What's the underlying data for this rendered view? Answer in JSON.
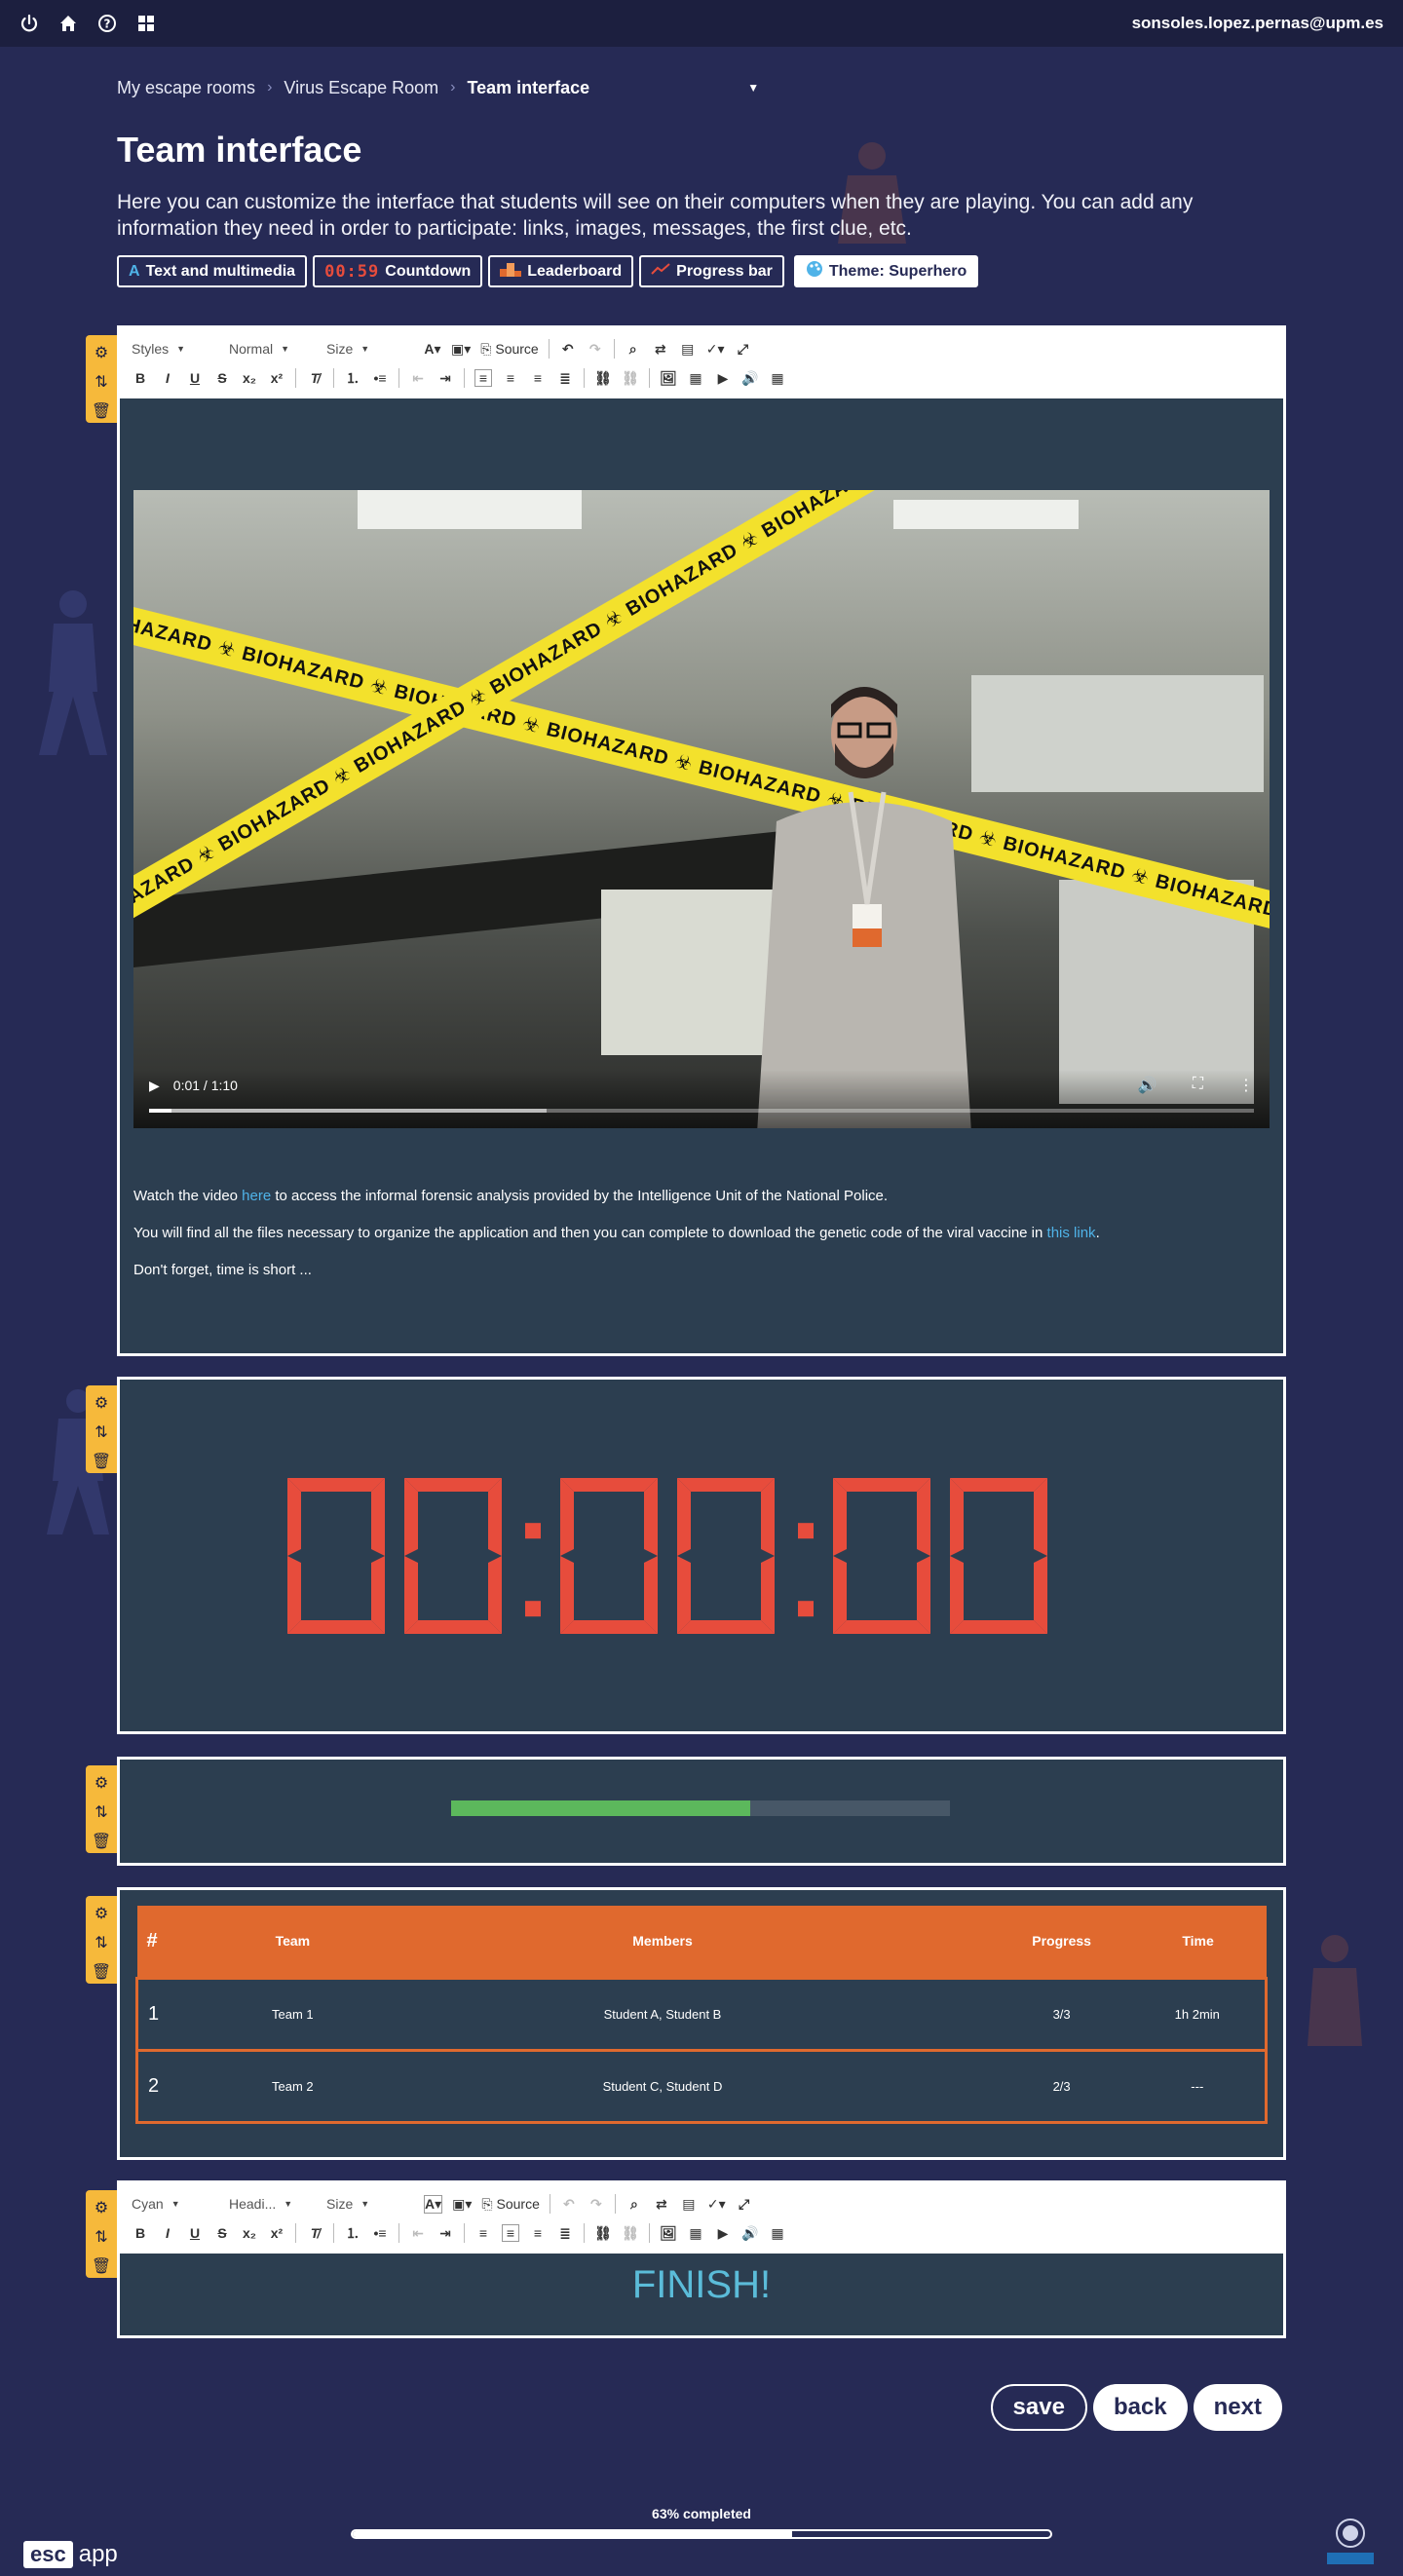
{
  "user": {
    "email": "sonsoles.lopez.pernas@upm.es"
  },
  "breadcrumb": {
    "item1": "My escape rooms",
    "item2": "Virus Escape Room",
    "current": "Team interface"
  },
  "page": {
    "title": "Team interface",
    "description": "Here you can customize the interface that students will see on their computers when they are playing. You can add any information they need in order to participate: links, images, messages, the first clue, etc."
  },
  "toolbar": {
    "text_multimedia": "Text and multimedia",
    "countdown_digits": "00:59",
    "countdown": "Countdown",
    "leaderboard": "Leaderboard",
    "progress_bar": "Progress bar",
    "theme": "Theme: Superhero"
  },
  "editor": {
    "styles": "Styles",
    "normal": "Normal",
    "size": "Size",
    "source": "Source"
  },
  "editor2": {
    "color": "Cyan",
    "heading": "Headi...",
    "size": "Size",
    "source": "Source"
  },
  "video": {
    "tape_text": "BIOHAZARD ☣ BIOHAZARD ☣ BIOHAZARD ☣ BIOHAZARD ☣ BIOHAZARD ☣ BIOHAZARD ☣ BIOHAZARD ☣ BIOHAZARD",
    "time": "0:01 / 1:10",
    "played_fraction": 0.02
  },
  "text_block": {
    "p1_before": "Watch the video ",
    "p1_link": "here",
    "p1_after": " to access the informal forensic analysis provided by the Intelligence Unit of the National Police.",
    "p2_before": "You will find all the files necessary to organize the application and then you can complete to download the genetic code of the viral vaccine in ",
    "p2_link": "this link",
    "p2_after": ".",
    "p3": "Don't forget, time is short ..."
  },
  "countdown": {
    "value": "00:00:00",
    "color": "#e74c3c"
  },
  "progress": {
    "fraction": 0.6
  },
  "leaderboard": {
    "headers": {
      "rank": "#",
      "team": "Team",
      "members": "Members",
      "progress": "Progress",
      "time": "Time"
    },
    "rows": [
      {
        "rank": "1",
        "team": "Team 1",
        "members": "Student A, Student B",
        "progress": "3/3",
        "time": "1h 2min"
      },
      {
        "rank": "2",
        "team": "Team 2",
        "members": "Student C, Student D",
        "progress": "2/3",
        "time": "---"
      }
    ],
    "accent": "#e0692e"
  },
  "finish": {
    "text": "FINISH!"
  },
  "buttons": {
    "save": "save",
    "back": "back",
    "next": "next"
  },
  "footer": {
    "progress_label": "63% completed",
    "progress_fraction": 0.63,
    "logo_box": "esc",
    "logo_app": "app"
  },
  "colors": {
    "background": "#262a55",
    "panel": "#2c3e50",
    "accent_yellow": "#f6b93b",
    "green": "#5cb85c"
  }
}
